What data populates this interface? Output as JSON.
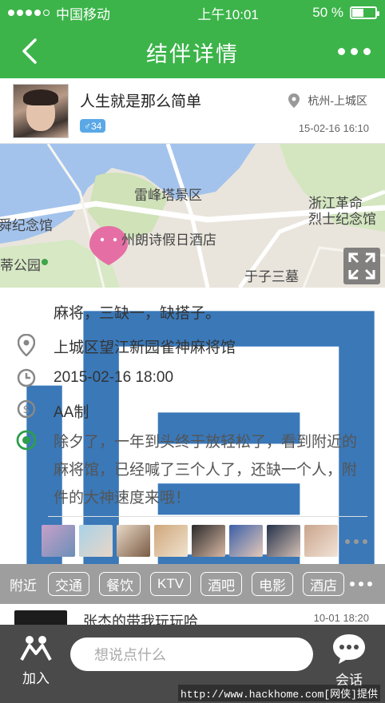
{
  "status": {
    "carrier": "中国移动",
    "time": "上午10:01",
    "battery_text": "50 %",
    "battery_level": 0.5
  },
  "nav": {
    "title": "结伴详情"
  },
  "profile": {
    "name": "人生就是那么简单",
    "gender_badge": "♂34",
    "location": "杭州-上城区",
    "posted_at": "15-02-16  16:10"
  },
  "map": {
    "labels": {
      "leifeng": "雷峰塔景区",
      "zhejiang": "浙江革命",
      "martyrs": "烈士纪念馆",
      "memorial": "舜纪念馆",
      "park": "蒂公园",
      "hotel": "州朗诗假日酒店",
      "tomb": "于子三墓"
    }
  },
  "details": {
    "activity": "麻将，三缺一，缺搭子。",
    "address": "上城区望江新园雀神麻将馆",
    "datetime": "2015-02-16  18:00",
    "payment": "AA制",
    "description": "除夕了，一年到头终于放轻松了，看到附近的麻将馆，已经喊了三个人了，还缺一个人，附件的大神速度来哦！"
  },
  "participants": [
    {
      "color_a": "#c7a0c9",
      "color_b": "#6c8fb8"
    },
    {
      "color_a": "#a9d2e8",
      "color_b": "#e8d6c7"
    },
    {
      "color_a": "#e9d9c7",
      "color_b": "#7a5c45"
    },
    {
      "color_a": "#cfa77b",
      "color_b": "#f0e2cf"
    },
    {
      "color_a": "#2a2a2a",
      "color_b": "#d9b8a5"
    },
    {
      "color_a": "#3b5fa8",
      "color_b": "#e5c9b8"
    },
    {
      "color_a": "#24324a",
      "color_b": "#d6c1b6"
    },
    {
      "color_a": "#caa58c",
      "color_b": "#f2e3d8"
    }
  ],
  "nearby": {
    "label": "附近",
    "tags": [
      "交通",
      "餐饮",
      "KTV",
      "酒吧",
      "电影",
      "酒店"
    ]
  },
  "preview": {
    "name": "张杰的带我玩玩哈",
    "time": "10-01  18:20"
  },
  "bottom": {
    "join_label": "加入",
    "input_placeholder": "想说点什么",
    "chat_label": "会话",
    "watermark": "http://www.hackhome.com[网侠]提供"
  },
  "colors": {
    "brand_green": "#3cb44a",
    "icon_blue": "#3a78b8",
    "target_green": "#2e9e4c",
    "pin_pink": "#e56fa5"
  }
}
